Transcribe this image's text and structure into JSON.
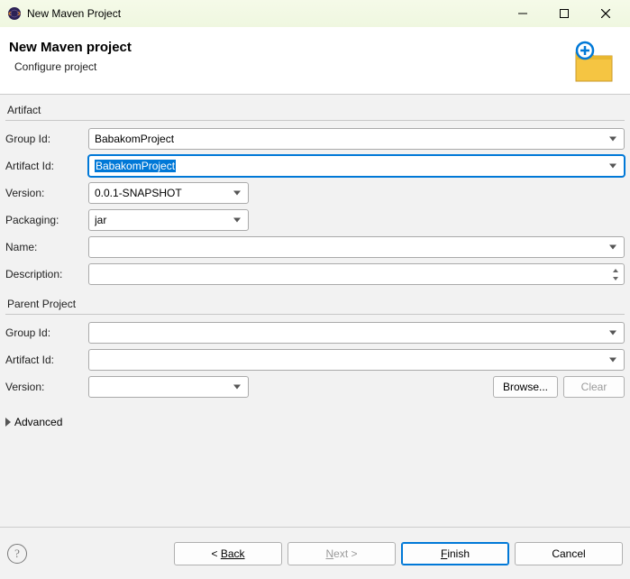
{
  "window": {
    "title": "New Maven Project"
  },
  "header": {
    "title": "New Maven project",
    "subtitle": "Configure project"
  },
  "artifact": {
    "section": "Artifact",
    "groupIdLabel": "Group Id:",
    "groupId": "BabakomProject",
    "artifactIdLabel": "Artifact Id:",
    "artifactId": "BabakomProject",
    "versionLabel": "Version:",
    "version": "0.0.1-SNAPSHOT",
    "packagingLabel": "Packaging:",
    "packaging": "jar",
    "nameLabel": "Name:",
    "name": "",
    "descriptionLabel": "Description:",
    "description": ""
  },
  "parent": {
    "section": "Parent Project",
    "groupIdLabel": "Group Id:",
    "groupId": "",
    "artifactIdLabel": "Artifact Id:",
    "artifactId": "",
    "versionLabel": "Version:",
    "version": "",
    "browse": "Browse...",
    "clear": "Clear"
  },
  "advanced": "Advanced",
  "footer": {
    "back": "Back",
    "next": "Next >",
    "finish": "Finish",
    "cancel": "Cancel"
  }
}
